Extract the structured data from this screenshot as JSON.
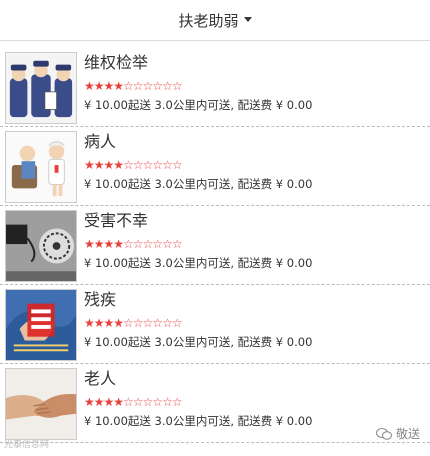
{
  "header": {
    "title": "扶老助弱"
  },
  "items": [
    {
      "title": "维权检举",
      "rating": 4,
      "max_rating": 10,
      "meta": "¥ 10.00起送 3.0公里内可送, 配送费 ¥ 0.00",
      "thumb_icon": "police-officers-image"
    },
    {
      "title": "病人",
      "rating": 4,
      "max_rating": 10,
      "meta": "¥ 10.00起送 3.0公里内可送, 配送费 ¥ 0.00",
      "thumb_icon": "patient-nurse-image"
    },
    {
      "title": "受害不幸",
      "rating": 4,
      "max_rating": 10,
      "meta": "¥ 10.00起送 3.0公里内可送, 配送费 ¥ 0.00",
      "thumb_icon": "fraud-warning-image"
    },
    {
      "title": "残疾",
      "rating": 4,
      "max_rating": 10,
      "meta": "¥ 10.00起送 3.0公里内可送, 配送费 ¥ 0.00",
      "thumb_icon": "love-disability-image"
    },
    {
      "title": "老人",
      "rating": 4,
      "max_rating": 10,
      "meta": "¥ 10.00起送 3.0公里内可送, 配送费 ¥ 0.00",
      "thumb_icon": "holding-hands-image"
    }
  ],
  "watermark": {
    "left": "光泰信息网",
    "right": "敬送"
  },
  "colors": {
    "star": "#e8413c",
    "divider": "#bbbbbb"
  }
}
